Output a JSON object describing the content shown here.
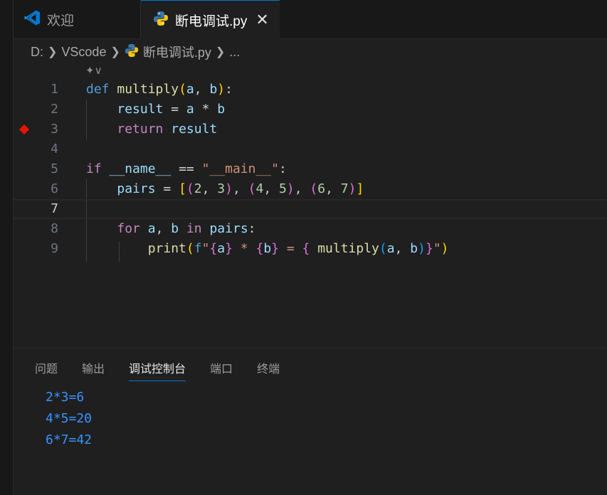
{
  "tabs": [
    {
      "label": "欢迎",
      "icon": "vscode-logo-icon",
      "active": false
    },
    {
      "label": "断电调试.py",
      "icon": "python-icon",
      "active": true,
      "close": "✕"
    }
  ],
  "breadcrumb": {
    "drive": "D:",
    "folder": "VScode",
    "file": "断电调试.py",
    "more": "..."
  },
  "editor": {
    "lines": [
      {
        "n": "1"
      },
      {
        "n": "2"
      },
      {
        "n": "3",
        "breakpoint": true
      },
      {
        "n": "4"
      },
      {
        "n": "5"
      },
      {
        "n": "6"
      },
      {
        "n": "7",
        "current": true
      },
      {
        "n": "8"
      },
      {
        "n": "9"
      }
    ]
  },
  "panel": {
    "tabs": [
      "问题",
      "输出",
      "调试控制台",
      "端口",
      "终端"
    ],
    "active_tab": "调试控制台",
    "output": [
      "2*3=6",
      "4*5=20",
      "6*7=42"
    ]
  },
  "colors": {
    "accent": "#0078d4",
    "breakpoint": "#e51400",
    "console_text": "#3794ff"
  }
}
